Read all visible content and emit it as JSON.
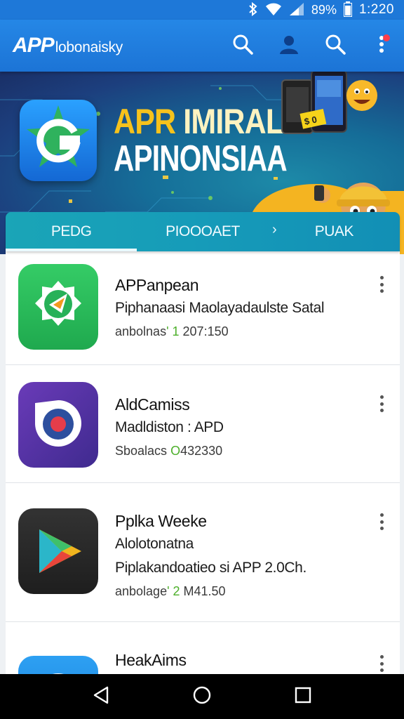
{
  "status_bar": {
    "icons": [
      "bluetooth-icon",
      "wifi-icon",
      "signal-icon",
      "battery-icon"
    ],
    "battery": "89%",
    "time": "1:220"
  },
  "app_bar": {
    "logo_mark": "APP",
    "logo_text": "lobonaisky",
    "actions": [
      "search-icon",
      "account-icon",
      "search-icon",
      "more-vert-icon"
    ],
    "color": "#1e7ddc"
  },
  "banner": {
    "title_line1_a": "APR ",
    "title_line1_b": "IMIRAL",
    "title_line2": "APINONSIAA",
    "price_tag": "$ 0",
    "accent": "#f6c21c"
  },
  "tabs": [
    {
      "label": "PEDG",
      "active": true
    },
    {
      "label": "PIOOOAET",
      "active": false
    },
    {
      "label": "PUAK",
      "active": false
    }
  ],
  "apps": [
    {
      "name": "APPanpean",
      "lines": [
        "Piphanaasi Maolayadaulste Satal"
      ],
      "meta_prefix": "anbolnas",
      "meta_mid": "' 1",
      "meta_suffix": " 207:150",
      "icon": "compass-icon",
      "icon_color": "#2fc05c"
    },
    {
      "name": "AldCamiss",
      "lines": [
        "Madldiston : APD"
      ],
      "meta_prefix": "Sboalacs ",
      "meta_mid": "O",
      "meta_suffix": "432330",
      "icon": "camera-icon",
      "icon_color": "#5a35a8"
    },
    {
      "name": "Pplka Weeke",
      "lines": [
        "Alolotonatna",
        "Piplakandoatieo si APP 2.0Ch."
      ],
      "meta_prefix": "anbolage",
      "meta_mid": "' 2",
      "meta_suffix": " M41.50",
      "icon": "play-store-icon",
      "icon_color": "#2b2b2b"
    },
    {
      "name": "HeakAims",
      "lines": [],
      "meta_prefix": "",
      "meta_mid": "",
      "meta_suffix": "",
      "icon": "refresh-icon",
      "icon_color": "#1f8fe8"
    }
  ],
  "nav_bar": {
    "buttons": [
      "back-icon",
      "home-icon",
      "recents-icon"
    ]
  }
}
